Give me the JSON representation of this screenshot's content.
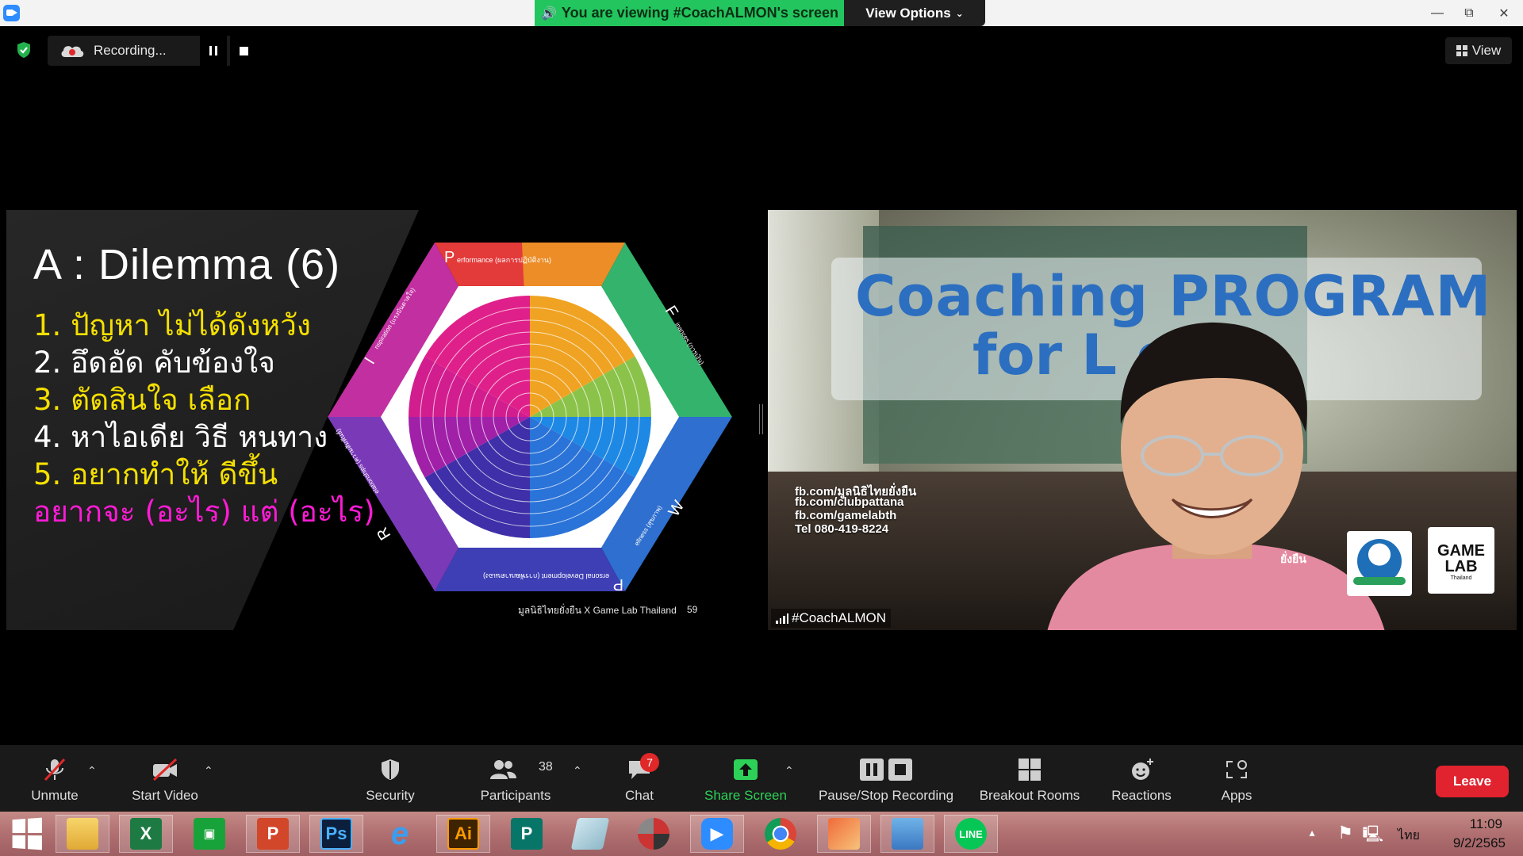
{
  "titlebar": {
    "viewing_banner": "You are viewing #CoachALMON's screen",
    "view_options": "View Options",
    "icons": [
      "zoom-logo-icon",
      "speaker-icon",
      "chevron-down-icon",
      "minimize-icon",
      "restore-icon",
      "close-icon"
    ]
  },
  "meeting_bar": {
    "recording_label": "Recording...",
    "view_label": "View"
  },
  "share": {
    "title": "A : Dilemma (6)",
    "lines": [
      "1. ปัญหา ไม่ได้ดังหวัง",
      "2. อึดอัด คับข้องใจ",
      "3. ตัดสินใจ เลือก",
      "4. หาไอเดีย วิธี หนทาง",
      "5. อยากทำให้ ดีขึ้น",
      "อยากจะ (อะไร) แต่ (อะไร)"
    ],
    "wheel_letters": [
      "P",
      "F",
      "W",
      "P",
      "R",
      "I"
    ],
    "wheel_labels": {
      "top": "erformance (ผลการปฏิบัติงาน)",
      "upper_right": "inances (การเงิน)",
      "lower_right": "ellness (สุขภาพ)",
      "bottom": "ersonal Development (การพัฒนาตนเอง)",
      "lower_left": "elationships (ความสัมพันธ์)",
      "upper_left": "nspiration (แรงบันดาลใจ)"
    },
    "credit": "มูลนิธิไทยยั่งยืน X Game Lab Thailand",
    "slide_number": "59"
  },
  "video": {
    "banner_line1": "Coaching PROGRAM",
    "banner_line2": "for L       er",
    "fb_lines": [
      "fb.com/มูลนิธิไทยยั่งยืน",
      "fb.com/clubpattana",
      "fb.com/gamelabth",
      "Tel 080-419-8224"
    ],
    "side_text": "ยั่งยืน",
    "logo2_line1": "GAME",
    "logo2_line2": "LAB",
    "logo2_small": "Thailand",
    "participant_name": "#CoachALMON"
  },
  "toolbar": {
    "unmute": "Unmute",
    "start_video": "Start Video",
    "security": "Security",
    "participants": "Participants",
    "participants_count": "38",
    "chat": "Chat",
    "chat_badge": "7",
    "share_screen": "Share Screen",
    "pause_stop_recording": "Pause/Stop Recording",
    "breakout_rooms": "Breakout Rooms",
    "reactions": "Reactions",
    "apps": "Apps",
    "leave": "Leave"
  },
  "taskbar": {
    "apps": [
      "file-explorer",
      "excel",
      "store",
      "powerpoint",
      "photoshop",
      "internet-explorer",
      "illustrator",
      "publisher",
      "notes",
      "fotoscape",
      "zoom",
      "chrome",
      "office-picture",
      "remote-desktop",
      "line"
    ],
    "excel_label": "X",
    "powerpoint_label": "P",
    "photoshop_label": "Ps",
    "illustrator_label": "Ai",
    "publisher_label": "P",
    "line_label": "LINE",
    "language": "ไทย",
    "time": "11:09",
    "date": "9/2/2565"
  },
  "colors": {
    "banner_green": "#23c55e",
    "share_green": "#2ed158",
    "leave_red": "#e0232e",
    "slide_yellow": "#f5e000",
    "slide_magenta": "#ff1bd6"
  }
}
